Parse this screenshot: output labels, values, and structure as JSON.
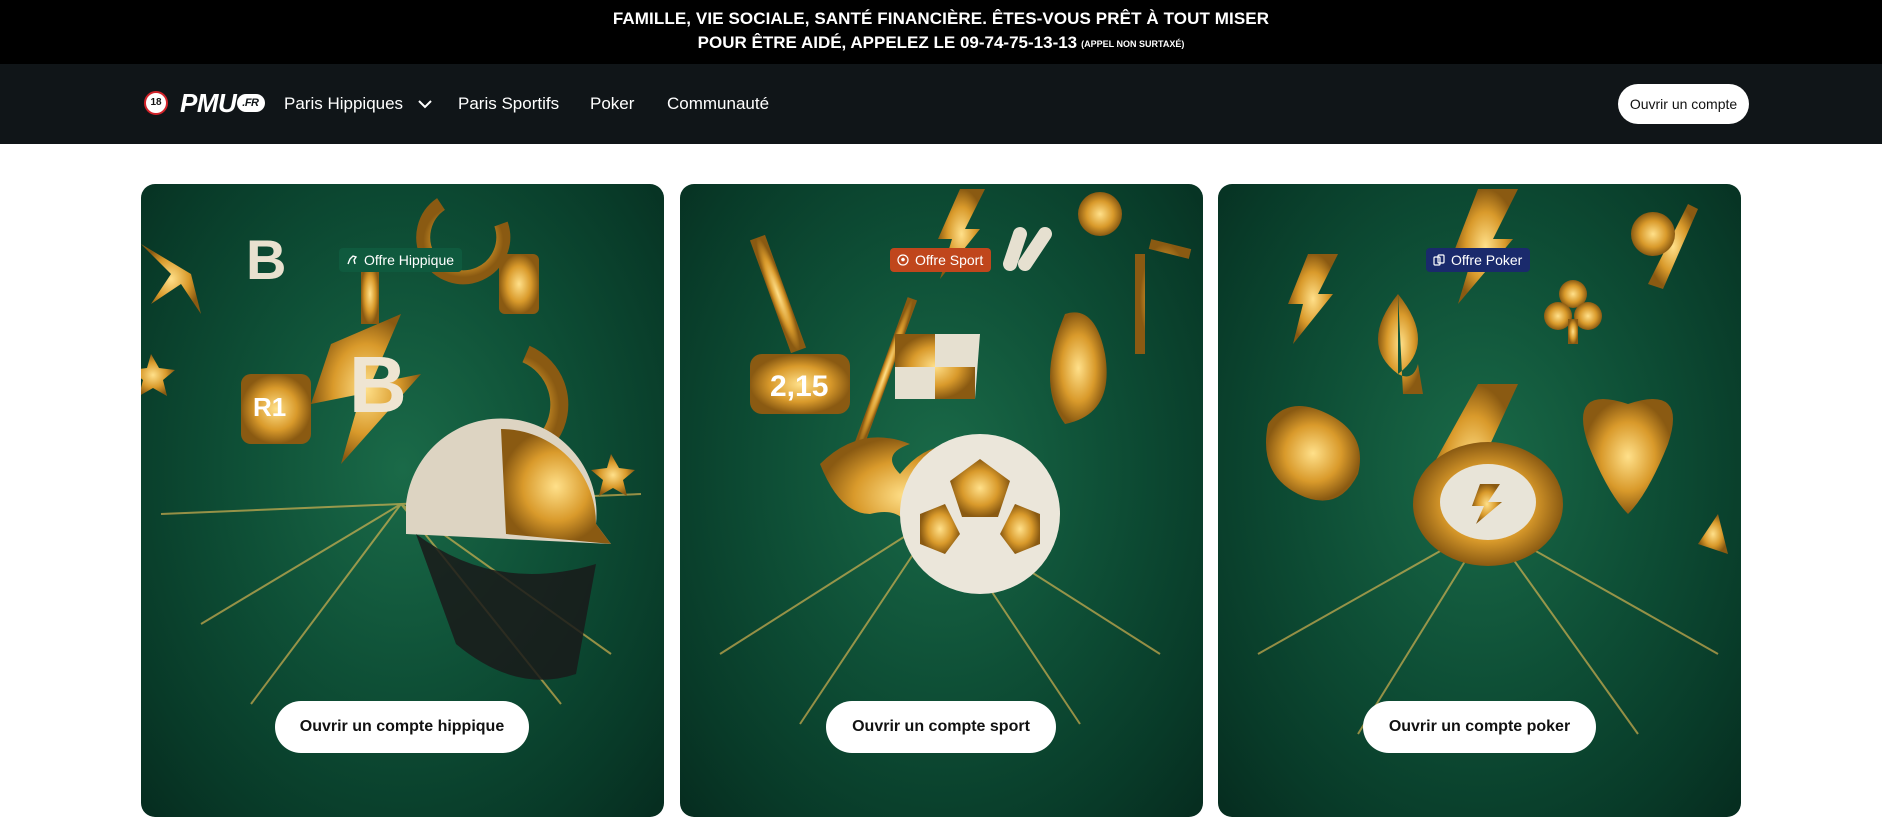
{
  "banner": {
    "line1": "FAMILLE, VIE SOCIALE, SANTÉ FINANCIÈRE. ÊTES-VOUS PRÊT À TOUT MISER",
    "line2": "POUR ÊTRE AIDÉ, APPELEZ LE 09-74-75-13-13",
    "line2_small": "(APPEL NON SURTAXÉ)"
  },
  "nav": {
    "age_badge": "18",
    "logo_text": "PMU",
    "logo_suffix": ".FR",
    "items": [
      {
        "label": "Paris Hippiques"
      },
      {
        "label": "Paris Sportifs"
      },
      {
        "label": "Poker"
      },
      {
        "label": "Communauté"
      }
    ],
    "open_account_label": "Ouvrir un compte"
  },
  "cards": [
    {
      "badge": "Offre Hippique",
      "badge_color": "#0f5a3e",
      "cta": "Ouvrir un compte hippique",
      "image": "jockey-helmet-horseshoe-illustration"
    },
    {
      "badge": "Offre Sport",
      "badge_color": "#c0461c",
      "cta": "Ouvrir un compte sport",
      "image": "football-whistle-flag-illustration"
    },
    {
      "badge": "Offre Poker",
      "badge_color": "#1a2a6c",
      "cta": "Ouvrir un compte poker",
      "image": "poker-chip-suits-illustration"
    }
  ]
}
